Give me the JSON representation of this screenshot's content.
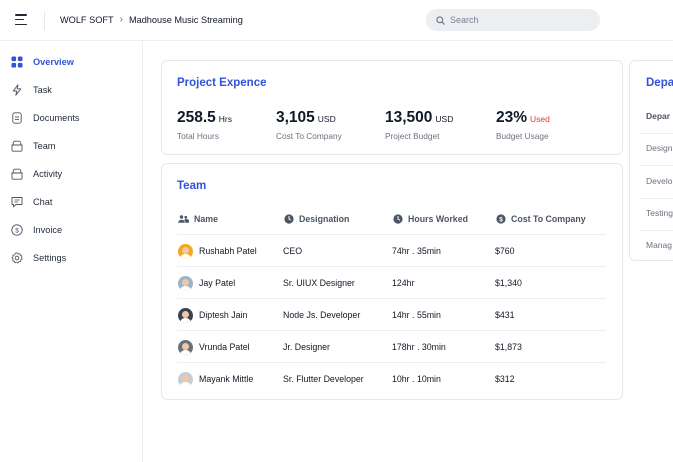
{
  "header": {
    "org": "WOLF SOFT",
    "project": "Madhouse Music Streaming",
    "search_placeholder": "Search"
  },
  "sidebar": {
    "items": [
      {
        "label": "Overview",
        "icon": "grid-icon",
        "active": true
      },
      {
        "label": "Task",
        "icon": "bolt-icon",
        "active": false
      },
      {
        "label": "Documents",
        "icon": "document-icon",
        "active": false
      },
      {
        "label": "Team",
        "icon": "team-icon",
        "active": false
      },
      {
        "label": "Activity",
        "icon": "activity-icon",
        "active": false
      },
      {
        "label": "Chat",
        "icon": "chat-icon",
        "active": false
      },
      {
        "label": "Invoice",
        "icon": "dollar-icon",
        "active": false
      },
      {
        "label": "Settings",
        "icon": "gear-icon",
        "active": false
      }
    ]
  },
  "project_expence": {
    "title": "Project Expence",
    "stats": [
      {
        "value": "258.5",
        "unit": "Hrs",
        "label": "Total Hours"
      },
      {
        "value": "3,105",
        "unit": "USD",
        "label": "Cost To Company"
      },
      {
        "value": "13,500",
        "unit": "USD",
        "label": "Project Budget"
      },
      {
        "value": "23%",
        "unit": "Used",
        "label": "Budget Usage"
      }
    ]
  },
  "team": {
    "title": "Team",
    "columns": [
      "Name",
      "Designation",
      "Hours Worked",
      "Cost To Company"
    ],
    "rows": [
      {
        "name": "Rushabh Patel",
        "designation": "CEO",
        "hours": "74hr . 35min",
        "cost": "$760",
        "avatar_bg": "#f4a91f"
      },
      {
        "name": "Jay Patel",
        "designation": "Sr. UIUX Designer",
        "hours": "124hr",
        "cost": "$1,340",
        "avatar_bg": "#9fb3c8"
      },
      {
        "name": "Diptesh Jain",
        "designation": "Node Js. Developer",
        "hours": "14hr . 55min",
        "cost": "$431",
        "avatar_bg": "#3b4250"
      },
      {
        "name": "Vrunda Patel",
        "designation": "Jr. Designer",
        "hours": "178hr . 30min",
        "cost": "$1,873",
        "avatar_bg": "#6b6f78"
      },
      {
        "name": "Mayank Mittle",
        "designation": "Sr. Flutter Developer",
        "hours": "10hr . 10min",
        "cost": "$312",
        "avatar_bg": "#c9cdd3"
      }
    ]
  },
  "department": {
    "title": "Depa",
    "header": "Depar",
    "rows": [
      "Design",
      "Develo",
      "Testing",
      "Manag"
    ]
  },
  "colors": {
    "accent": "#3153d8",
    "used_red": "#e53935"
  }
}
